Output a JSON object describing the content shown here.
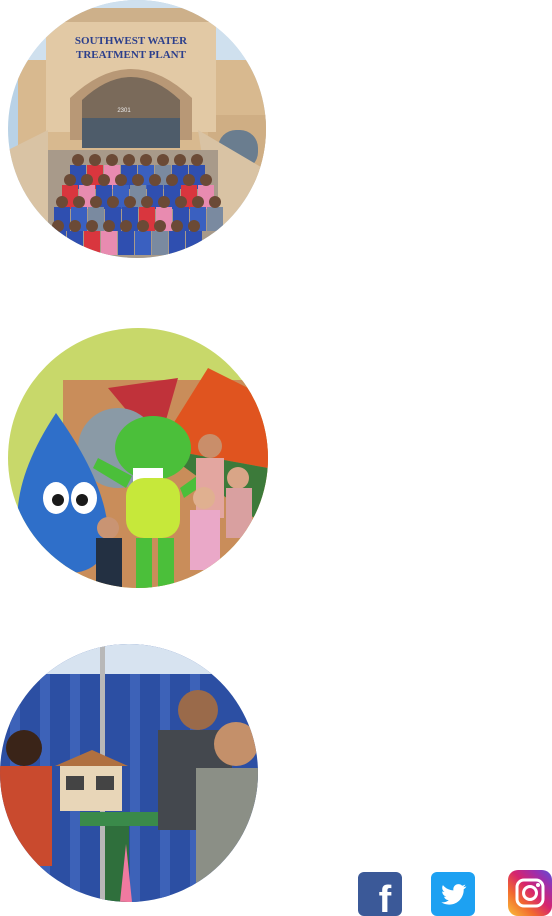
{
  "photos": [
    {
      "alt": "Students on steps of Southwest Water Treatment Plant",
      "sign_line1": "SOUTHWEST WATER",
      "sign_line2": "TREATMENT PLANT",
      "address": "2301"
    },
    {
      "alt": "Water drop and green alligator mascots with children"
    },
    {
      "alt": "Adults interacting at an exhibit table with a model house"
    }
  ],
  "social": {
    "facebook_label": "f",
    "facebook_icon": "facebook-icon",
    "twitter_icon": "twitter-icon",
    "instagram_icon": "instagram-icon",
    "colors": {
      "facebook": "#3b5998",
      "twitter": "#1da1f2",
      "instagram": "#d6246e"
    }
  }
}
